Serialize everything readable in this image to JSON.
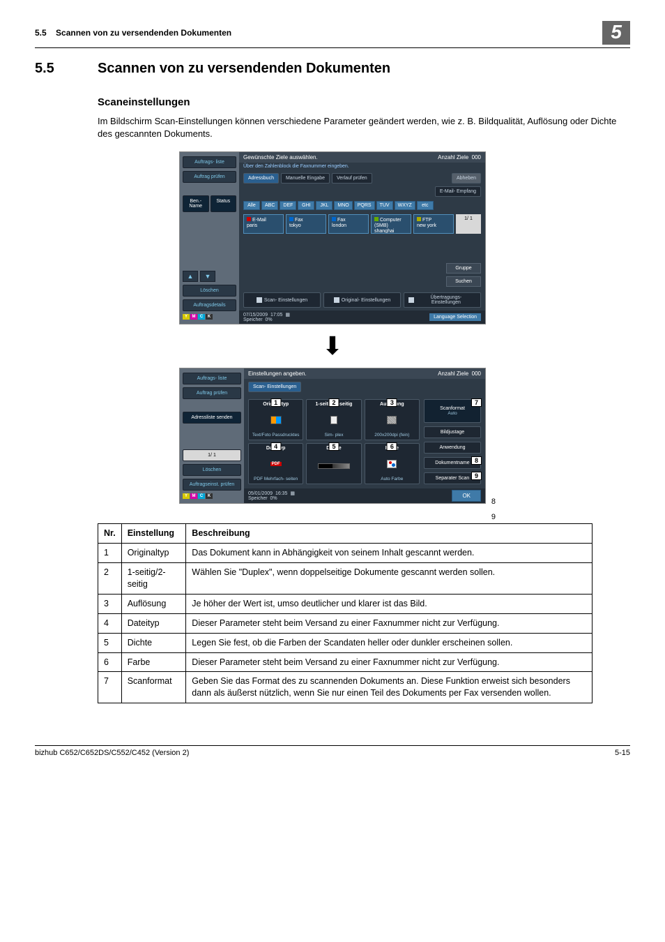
{
  "header": {
    "section_ref": "5.5",
    "section_title_ref": "Scannen von zu versendenden Dokumenten",
    "chapter": "5"
  },
  "h1": {
    "num": "5.5",
    "title": "Scannen von zu versendenden Dokumenten"
  },
  "h2": "Scaneinstellungen",
  "intro": "Im Bildschirm Scan-Einstellungen können verschiedene Parameter geändert werden, wie z. B. Bildqualität, Auflösung oder Dichte des gescannten Dokuments.",
  "panel1": {
    "left": {
      "auftragsliste": "Auftrags-\nliste",
      "auftrag_pruefen": "Auftrag\nprüfen",
      "ben_name": "Ben.-\nName",
      "status": "Status",
      "loeschen": "Löschen",
      "auftragsdetails": "Auftragsdetails"
    },
    "top_msg": "Gewünschte Ziele auswählen.",
    "top_info": "Über den Zahlenblock die Faxnummer eingeben.",
    "anzahl_label": "Anzahl\nZiele",
    "anzahl_val": "000",
    "tabs": {
      "adressbuch": "Adressbuch",
      "manuelle": "Manuelle\nEingabe",
      "verlauf": "Verlauf\nprüfen",
      "abheben": "Abheben"
    },
    "email_empfang": "E-Mail-\nEmpfang",
    "filters": [
      "Alle",
      "ABC",
      "DEF",
      "GHI",
      "JKL",
      "MNO",
      "PQRS",
      "TUV",
      "WXYZ",
      "etc"
    ],
    "dests": [
      {
        "type": "E-Mail",
        "name": "paris",
        "ic": "#c00"
      },
      {
        "type": "Fax",
        "name": "tokyo",
        "ic": "#06c"
      },
      {
        "type": "Fax",
        "name": "london",
        "ic": "#06c"
      },
      {
        "type": "Computer\n(SMB)",
        "name": "shanghai",
        "ic": "#6a0"
      },
      {
        "type": "FTP",
        "name": "new york",
        "ic": "#aa0"
      }
    ],
    "pager": "1/  1",
    "gruppe": "Gruppe",
    "suchen": "Suchen",
    "bottom": {
      "scan": "Scan-\nEinstellungen",
      "original": "Original-\nEinstellungen",
      "uebertrag": "Übertragungs-\nEinstellungen"
    },
    "status": {
      "date": "07/15/2009",
      "time": "17:05",
      "mem": "Speicher",
      "memv": "0%",
      "lang": "Language Selection"
    }
  },
  "panel2": {
    "left": {
      "auftragsliste": "Auftrags-\nliste",
      "auftrag_pruefen": "Auftrag\nprüfen",
      "adressliste": "Adressliste senden",
      "loeschen": "Löschen",
      "auftrags_einst": "Auftragseinst.\nprüfen",
      "pager": "1/  1"
    },
    "top_msg": "Einstellungen angeben.",
    "anzahl_label": "Anzahl\nZiele",
    "anzahl_val": "000",
    "tab_scan": "Scan-\nEinstellungen",
    "tiles": [
      {
        "n": "1",
        "label": "Originaltyp",
        "val": "Text/Foto\nPassdrucktes"
      },
      {
        "n": "2",
        "label": "1-seitig/\n2-seitig",
        "val": "Sim-\nplex"
      },
      {
        "n": "3",
        "label": "Auflösung",
        "val": "200x200dpi\n(fein)"
      },
      {
        "n": "4",
        "label": "Dateityp",
        "val": "PDF\nMehrfach-\nseiten"
      },
      {
        "n": "5",
        "label": "Dichte",
        "val": ""
      },
      {
        "n": "6",
        "label": "Farbe",
        "val": "Auto Farbe"
      }
    ],
    "side": [
      {
        "n": "7",
        "label": "Scanformat",
        "sub": "Auto"
      },
      {
        "n": "",
        "label": "Bildjustage",
        "sub": ""
      },
      {
        "n": "",
        "label": "Anwendung",
        "sub": ""
      },
      {
        "n": "8",
        "label": "Dokumentname",
        "sub": ""
      },
      {
        "n": "9",
        "label": "Separater Scan",
        "sub": ""
      }
    ],
    "ok": "OK",
    "status": {
      "date": "05/01/2009",
      "time": "16:35",
      "mem": "Speicher",
      "memv": "0%"
    }
  },
  "table": {
    "head": [
      "Nr.",
      "Einstellung",
      "Beschreibung"
    ],
    "rows": [
      [
        "1",
        "Originaltyp",
        "Das Dokument kann in Abhängigkeit von seinem Inhalt gescannt werden."
      ],
      [
        "2",
        "1-seitig/2-seitig",
        "Wählen Sie \"Duplex\", wenn doppelseitige Dokumente gescannt werden sollen."
      ],
      [
        "3",
        "Auflösung",
        "Je höher der Wert ist, umso deutlicher und klarer ist das Bild."
      ],
      [
        "4",
        "Dateityp",
        "Dieser Parameter steht beim Versand zu einer Faxnummer nicht zur Verfügung."
      ],
      [
        "5",
        "Dichte",
        "Legen Sie fest, ob die Farben der Scandaten heller oder dunkler erscheinen sollen."
      ],
      [
        "6",
        "Farbe",
        "Dieser Parameter steht beim Versand zu einer Faxnummer nicht zur Verfügung."
      ],
      [
        "7",
        "Scanformat",
        "Geben Sie das Format des zu scannenden Dokuments an. Diese Funktion erweist sich besonders dann als äußerst nützlich, wenn Sie nur einen Teil des Dokuments per Fax versenden wollen."
      ]
    ]
  },
  "footer": {
    "model": "bizhub C652/C652DS/C552/C452 (Version 2)",
    "page": "5-15"
  }
}
